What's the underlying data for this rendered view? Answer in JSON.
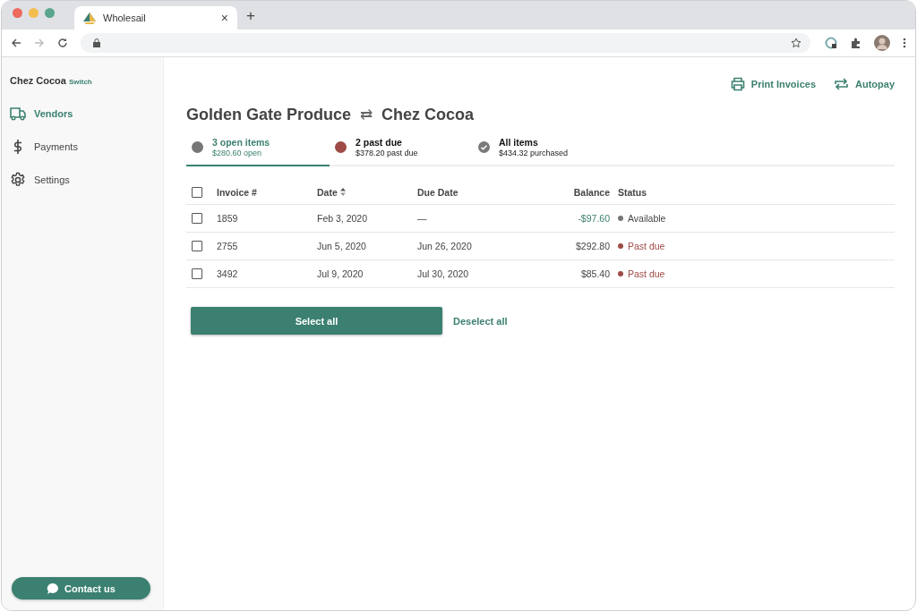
{
  "browser": {
    "tab_title": "Wholesail",
    "new_tab": "+",
    "close_tab": "×"
  },
  "sidebar": {
    "account": "Chez Cocoa",
    "switch": "Switch",
    "items": [
      {
        "label": "Vendors",
        "selected": true
      },
      {
        "label": "Payments",
        "selected": false
      },
      {
        "label": "Settings",
        "selected": false
      }
    ],
    "contact": "Contact us"
  },
  "actions": [
    {
      "label": "Print Invoices"
    },
    {
      "label": "Autopay"
    }
  ],
  "title": {
    "from": "Golden Gate Produce",
    "arrow": "⇄",
    "to": "Chez Cocoa"
  },
  "summary_tabs": [
    {
      "label": "3 open items",
      "sub": "$280.60 open",
      "selected": true,
      "kind": "dot",
      "color": "#777777"
    },
    {
      "label": "2 past due",
      "sub": "$378.20 past due",
      "selected": false,
      "kind": "dot",
      "color": "#9e4a45"
    },
    {
      "label": "All items",
      "sub": "$434.32 purchased",
      "selected": false,
      "kind": "check",
      "color": "#7a7a7a"
    }
  ],
  "table": {
    "columns": [
      "Invoice #",
      "Date",
      "Due Date",
      "Balance",
      "Status"
    ],
    "header_checked": false,
    "rows": [
      {
        "checked": false,
        "invoice": "1859",
        "date": "Feb 3, 2020",
        "due": "—",
        "balance": "-$97.60",
        "credit": true,
        "status": "Available",
        "color": "#777777",
        "past_due": false
      },
      {
        "checked": false,
        "invoice": "2755",
        "date": "Jun 5, 2020",
        "due": "Jun 26, 2020",
        "balance": "$292.80",
        "credit": false,
        "status": "Past due",
        "color": "#9e4a45",
        "past_due": true
      },
      {
        "checked": false,
        "invoice": "3492",
        "date": "Jul 9, 2020",
        "due": "Jul 30, 2020",
        "balance": "$85.40",
        "credit": false,
        "status": "Past due",
        "color": "#9e4a45",
        "past_due": true
      }
    ]
  },
  "buttons": {
    "select_all": "Select all",
    "deselect_all": "Deselect all"
  }
}
